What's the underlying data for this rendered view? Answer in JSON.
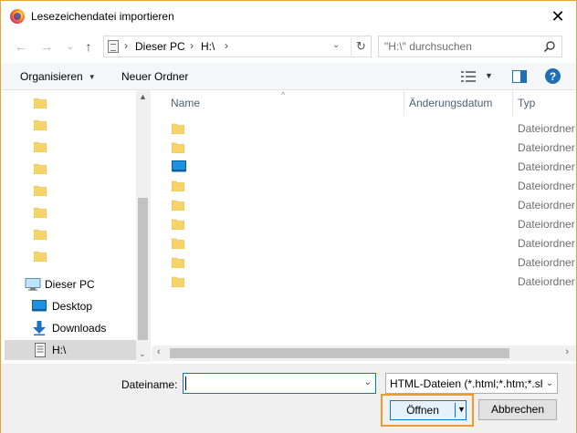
{
  "window": {
    "title": "Lesezeichendatei importieren",
    "close_glyph": "✕"
  },
  "address": {
    "back_glyph": "←",
    "forward_glyph": "→",
    "recent_glyph": "⌄",
    "up_glyph": "↑",
    "crumbs": [
      "Dieser PC",
      "H:\\"
    ],
    "crumb_sep": "›",
    "dropdown_glyph": "⌄",
    "refresh_glyph": "↻"
  },
  "search": {
    "placeholder": "\"H:\\\" durchsuchen"
  },
  "toolbar": {
    "organize_label": "Organisieren",
    "organize_caret": "▼",
    "new_folder_label": "Neuer Ordner",
    "view_dd_glyph": "▼",
    "help_glyph": "?"
  },
  "nav": {
    "folders_count_visible": 8,
    "pc_label": "Dieser PC",
    "items": [
      {
        "label": "Desktop"
      },
      {
        "label": "Downloads"
      },
      {
        "label": "H:\\"
      }
    ],
    "scroll_up_glyph": "▲",
    "scroll_down_glyph": "⌄"
  },
  "columns": {
    "name": "Name",
    "date": "Änderungsdatum",
    "type": "Typ",
    "sort_glyph": "^"
  },
  "files": [
    {
      "icon": "folder-icon",
      "type": "Dateiordner"
    },
    {
      "icon": "folder-icon",
      "type": "Dateiordner"
    },
    {
      "icon": "desktop-folder-icon",
      "type": "Dateiordner"
    },
    {
      "icon": "folder-icon",
      "type": "Dateiordner"
    },
    {
      "icon": "folder-icon",
      "type": "Dateiordner"
    },
    {
      "icon": "folder-icon",
      "type": "Dateiordner"
    },
    {
      "icon": "folder-icon",
      "type": "Dateiordner"
    },
    {
      "icon": "folder-icon",
      "type": "Dateiordner"
    },
    {
      "icon": "folder-icon",
      "type": "Dateiordner"
    }
  ],
  "hscroll": {
    "left_glyph": "‹",
    "right_glyph": "›"
  },
  "bottom": {
    "filename_label": "Dateiname:",
    "filename_value": "",
    "filename_dd_glyph": "⌄",
    "filter_value": "HTML-Dateien (*.html;*.htm;*.shtml)",
    "filter_dd_glyph": "⌄",
    "open_label": "Öffnen",
    "open_dd_glyph": "▼",
    "cancel_label": "Abbrechen"
  },
  "colors": {
    "accent": "#0078d7",
    "highlight_border": "#ef9a2c",
    "folder": "#f7d46a",
    "help": "#1e6fb5"
  }
}
